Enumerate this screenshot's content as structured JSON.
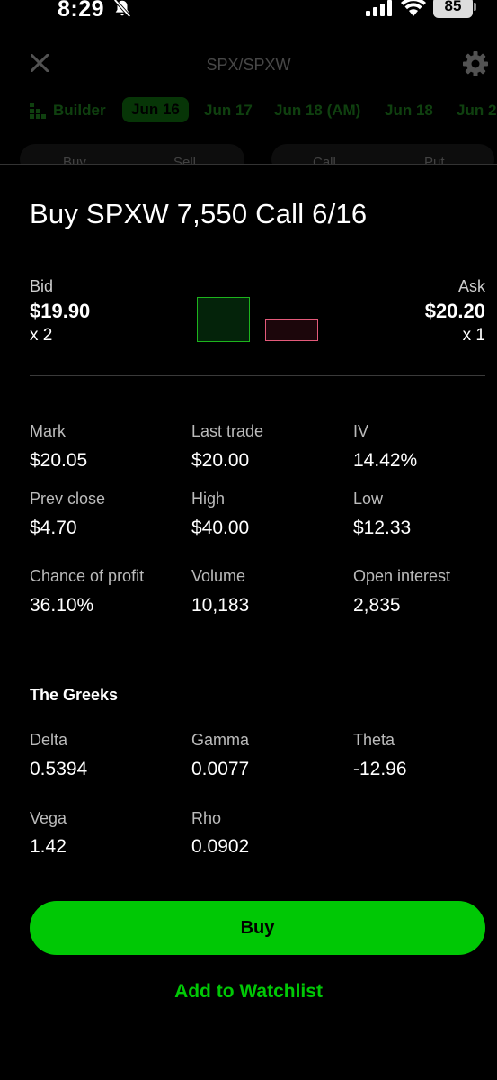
{
  "status_bar": {
    "time": "8:29",
    "battery": "85"
  },
  "background": {
    "title": "SPX/SPXW",
    "builder_label": "Builder",
    "date_tabs": [
      "Jun 16",
      "Jun 17",
      "Jun 18 (AM)",
      "Jun 18",
      "Jun 2"
    ],
    "active_date_tab": "Jun 16",
    "segments": {
      "buy": "Buy",
      "sell": "Sell",
      "call": "Call",
      "put": "Put"
    }
  },
  "sheet": {
    "title": "Buy SPXW 7,550 Call 6/16",
    "bid": {
      "label": "Bid",
      "price": "$19.90",
      "size": "x 2"
    },
    "ask": {
      "label": "Ask",
      "price": "$20.20",
      "size": "x 1"
    },
    "colors": {
      "accent_green": "#00c805",
      "bid_border": "#1db41d",
      "ask_border": "#e35a7a"
    },
    "stats": [
      {
        "label": "Mark",
        "value": "$20.05"
      },
      {
        "label": "Last trade",
        "value": "$20.00"
      },
      {
        "label": "IV",
        "value": "14.42%"
      },
      {
        "label": "Prev close",
        "value": "$4.70"
      },
      {
        "label": "High",
        "value": "$40.00"
      },
      {
        "label": "Low",
        "value": "$12.33"
      },
      {
        "label": "Chance of profit",
        "value": "36.10%"
      },
      {
        "label": "Volume",
        "value": "10,183"
      },
      {
        "label": "Open interest",
        "value": "2,835"
      }
    ],
    "greeks_title": "The Greeks",
    "greeks": [
      {
        "label": "Delta",
        "value": "0.5394"
      },
      {
        "label": "Gamma",
        "value": "0.0077"
      },
      {
        "label": "Theta",
        "value": "-12.96"
      },
      {
        "label": "Vega",
        "value": "1.42"
      },
      {
        "label": "Rho",
        "value": "0.0902"
      }
    ],
    "buy_button": "Buy",
    "watchlist_link": "Add to Watchlist"
  }
}
